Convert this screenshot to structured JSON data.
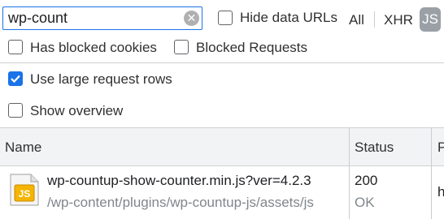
{
  "filter": {
    "search_value": "wp-count",
    "hide_data_urls_label": "Hide data URLs",
    "type_all": "All",
    "type_xhr": "XHR",
    "type_js": "JS"
  },
  "options": {
    "has_blocked_cookies": "Has blocked cookies",
    "blocked_requests": "Blocked Requests",
    "use_large_rows": "Use large request rows",
    "show_overview": "Show overview"
  },
  "table": {
    "columns": [
      "Name",
      "Status",
      "P"
    ],
    "rows": [
      {
        "name": "wp-countup-show-counter.min.js?ver=4.2.3",
        "path": "/wp-content/plugins/wp-countup-js/assets/js",
        "status_code": "200",
        "status_text": "OK",
        "extra": "h"
      }
    ]
  },
  "colors": {
    "accent": "#1a73e8",
    "js_badge": "#9aa0a6"
  }
}
